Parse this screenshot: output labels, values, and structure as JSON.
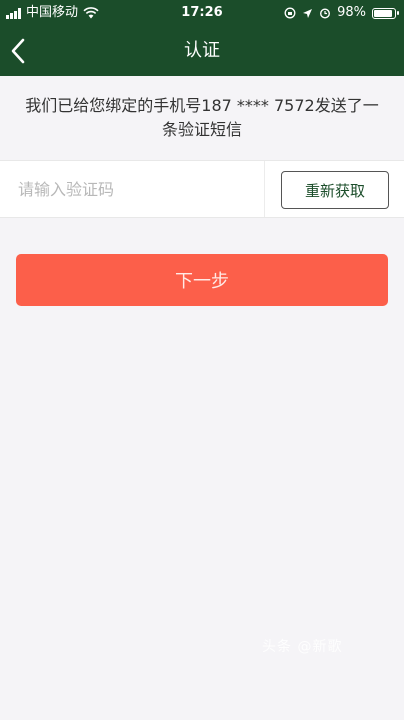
{
  "status_bar": {
    "carrier": "中国移动",
    "time": "17:26",
    "battery": "98%",
    "battery_level": 0.98
  },
  "nav": {
    "title": "认证"
  },
  "notice": {
    "text": "我们已给您绑定的手机号187 **** 7572发送了一条验证短信"
  },
  "form": {
    "code_placeholder": "请输入验证码",
    "code_value": "",
    "resend_label": "重新获取",
    "next_label": "下一步"
  },
  "watermark": "头条 @新歌",
  "colors": {
    "header": "#1b4d2a",
    "primary_button": "#fc5f4a",
    "background": "#f5f4f7"
  },
  "icons": [
    "signal-icon",
    "wifi-icon",
    "location-icon",
    "alarm-icon",
    "battery-icon",
    "back-chevron-icon"
  ]
}
